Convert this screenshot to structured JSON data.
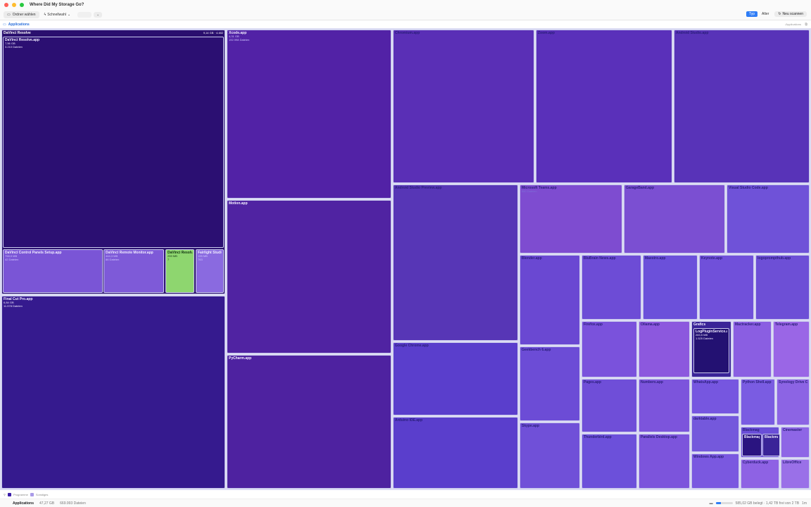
{
  "window": {
    "title": "Where Did My Storage Go?"
  },
  "toolbar": {
    "open_folder": "Ordner wählen",
    "quick_select": "Schnellwahl",
    "sort_type": "Typ",
    "sort_age": "Alter",
    "rescan": "Neu scannen"
  },
  "breadcrumb": {
    "current": "Applications",
    "path": "/Applications"
  },
  "legend": {
    "apps": "Programme",
    "other": "Sonstiges"
  },
  "status": {
    "name": "Applications",
    "size": "47,27 GB",
    "files": "669.993 Dateien",
    "disk_text": "585,02 GB belegt · 1,42 TB frei von 2 TB",
    "disk_used_fraction": 0.29,
    "extra": "1m"
  },
  "colors": {
    "apps": "#3b1ea8",
    "other": "#a99be8",
    "accent": "#2f7df6"
  },
  "treemap": {
    "davinci_group": {
      "name": "DaVinci Resolve",
      "size": "9,14 GB · 4.482"
    },
    "cells": [
      {
        "name": "DaVinci Resolve.app",
        "size": "7,56 GB",
        "count": "3.210 Dateien"
      },
      {
        "name": "DaVinci Control Panels Setup.app",
        "size": "758,9 MB",
        "count": "42 Dateien"
      },
      {
        "name": "DaVinci Remote Monitor.app",
        "size": "444,3 MB",
        "count": "86 Dateien"
      },
      {
        "name": "DaVinci Resolve Ma",
        "size": "259 MB",
        "count": "7"
      },
      {
        "name": "Fairlight Studio Util",
        "size": "195 MB",
        "count": "763"
      },
      {
        "name": "Final Cut Pro.app",
        "size": "6,84 GB",
        "count": "11.578 Dateien"
      },
      {
        "name": "Xcode.app",
        "size": "4,31 GB",
        "count": "192.998 Dateien"
      },
      {
        "name": "Motion.app",
        "size": "",
        "count": ""
      },
      {
        "name": "PyCharm.app",
        "size": "",
        "count": ""
      },
      {
        "name": "Chromium.app",
        "size": "",
        "count": ""
      },
      {
        "name": "Zoom.app",
        "size": "",
        "count": ""
      },
      {
        "name": "Android Studio.app",
        "size": "",
        "count": ""
      },
      {
        "name": "Android Studio Preview.app",
        "size": "",
        "count": ""
      },
      {
        "name": "Microsoft Teams.app",
        "size": "",
        "count": "880 Dateien"
      },
      {
        "name": "GarageBand.app",
        "size": "",
        "count": ""
      },
      {
        "name": "Visual Studio Code.app",
        "size": "",
        "count": ""
      },
      {
        "name": "Google Chrome.app",
        "size": "",
        "count": ""
      },
      {
        "name": "Blender.app",
        "size": "",
        "count": ""
      },
      {
        "name": "BluBrain News.app",
        "size": "",
        "count": ""
      },
      {
        "name": "Maestro.app",
        "size": "",
        "count": ""
      },
      {
        "name": "Keynote.app",
        "size": "",
        "count": ""
      },
      {
        "name": "logoprompthub.app",
        "size": "",
        "count": ""
      },
      {
        "name": "Firefox.app",
        "size": "",
        "count": ""
      },
      {
        "name": "Ollama.app",
        "size": "",
        "count": ""
      },
      {
        "name": "Grafics",
        "size": "",
        "count": ""
      },
      {
        "name": "LogPluginService.app",
        "size": "283,5 MB",
        "count": "1.525 Dateien"
      },
      {
        "name": "Mactracker.app",
        "size": "",
        "count": ""
      },
      {
        "name": "Telegram.app",
        "size": "",
        "count": ""
      },
      {
        "name": "Geekbench 6.app",
        "size": "",
        "count": ""
      },
      {
        "name": "Pages.app",
        "size": "",
        "count": ""
      },
      {
        "name": "Numbers.app",
        "size": "",
        "count": ""
      },
      {
        "name": "WhatsApp.app",
        "size": "",
        "count": ""
      },
      {
        "name": "Python Shell.app",
        "size": "",
        "count": ""
      },
      {
        "name": "Synology Drive Client",
        "size": "",
        "count": ""
      },
      {
        "name": "Arduino IDE.app",
        "size": "",
        "count": ""
      },
      {
        "name": "Skype.app",
        "size": "",
        "count": ""
      },
      {
        "name": "darktable.app",
        "size": "",
        "count": ""
      },
      {
        "name": "Blackmag",
        "size": "",
        "count": ""
      },
      {
        "name": "Blackmagic",
        "size": "",
        "count": ""
      },
      {
        "name": "Blackmagi",
        "size": "",
        "count": ""
      },
      {
        "name": "Cinemaster",
        "size": "",
        "count": ""
      },
      {
        "name": "Thunderbird.app",
        "size": "",
        "count": ""
      },
      {
        "name": "Parallels Desktop.app",
        "size": "",
        "count": ""
      },
      {
        "name": "Windows App.app",
        "size": "",
        "count": ""
      },
      {
        "name": "Cyberduck.app",
        "size": "",
        "count": ""
      },
      {
        "name": "LibreOffice",
        "size": "",
        "count": ""
      }
    ]
  }
}
